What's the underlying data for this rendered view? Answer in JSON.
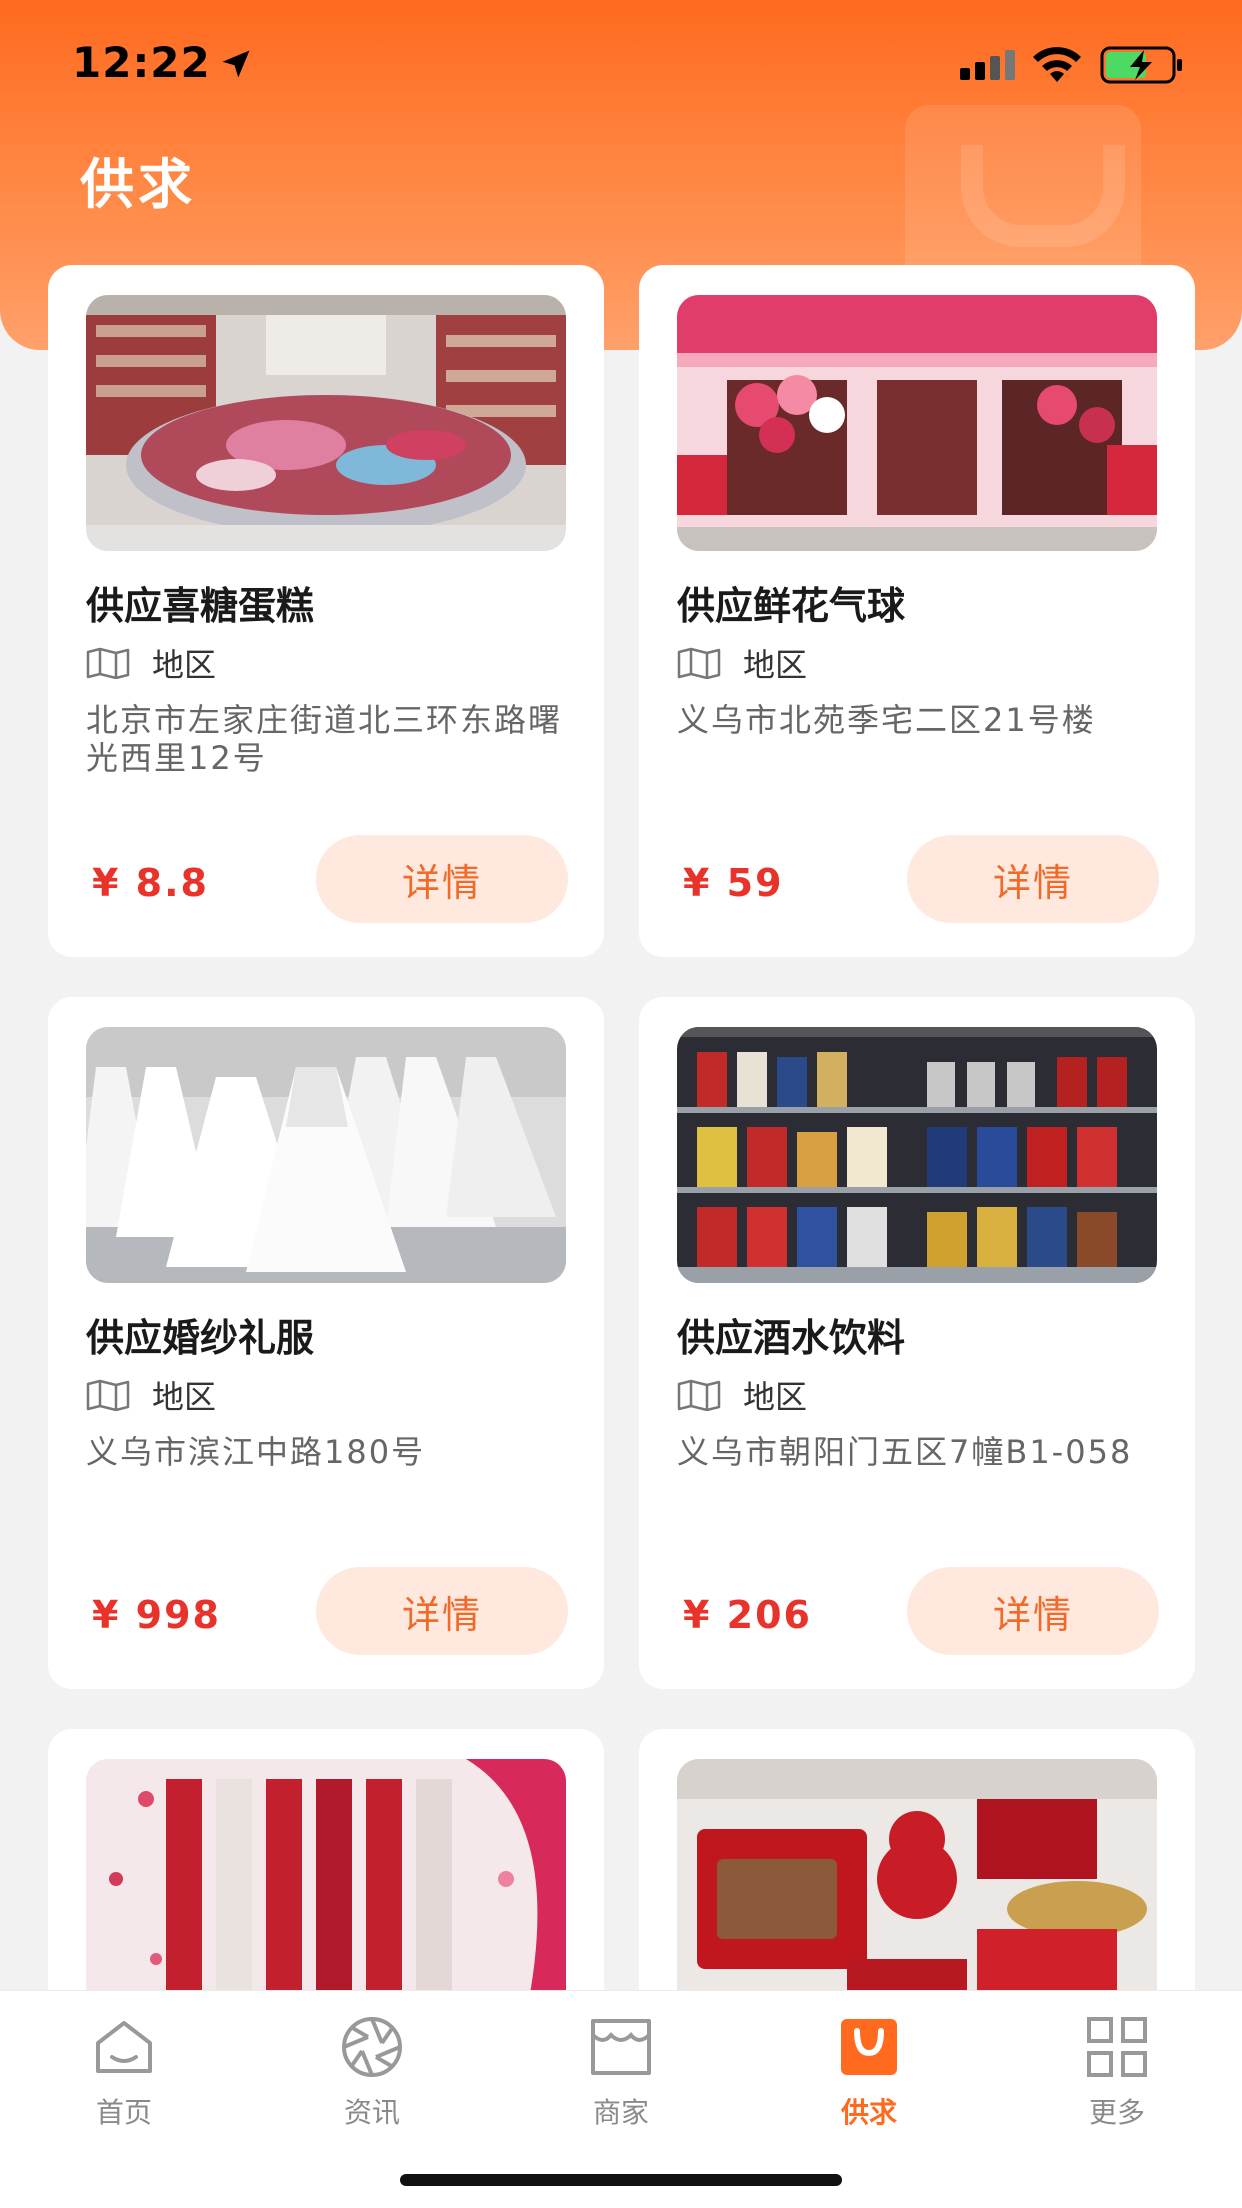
{
  "status_bar": {
    "time": "12:22"
  },
  "header": {
    "title": "供求"
  },
  "cards": [
    {
      "title": "供应喜糖蛋糕",
      "region_label": "地区",
      "address": "北京市左家庄街道北三环东路曙光西里12号",
      "price": "¥ 8.8",
      "button": "详情"
    },
    {
      "title": "供应鲜花气球",
      "region_label": "地区",
      "address": "义乌市北苑季宅二区21号楼",
      "price": "¥ 59",
      "button": "详情"
    },
    {
      "title": "供应婚纱礼服",
      "region_label": "地区",
      "address": "义乌市滨江中路180号",
      "price": "¥ 998",
      "button": "详情"
    },
    {
      "title": "供应酒水饮料",
      "region_label": "地区",
      "address": "义乌市朝阳门五区7幢B1-058",
      "price": "¥ 206",
      "button": "详情"
    },
    {
      "title": "",
      "region_label": "",
      "address": "",
      "price": "",
      "button": ""
    },
    {
      "title": "",
      "region_label": "",
      "address": "",
      "price": "",
      "button": ""
    }
  ],
  "tabbar": [
    {
      "label": "首页",
      "icon": "home-icon"
    },
    {
      "label": "资讯",
      "icon": "aperture-icon"
    },
    {
      "label": "商家",
      "icon": "store-icon"
    },
    {
      "label": "供求",
      "icon": "bag-icon",
      "active": true
    },
    {
      "label": "更多",
      "icon": "grid-icon"
    }
  ],
  "colors": {
    "accent": "#ff6a1f",
    "price": "#e8322a",
    "button_bg": "#ffe9de",
    "button_text": "#f06a2a"
  }
}
